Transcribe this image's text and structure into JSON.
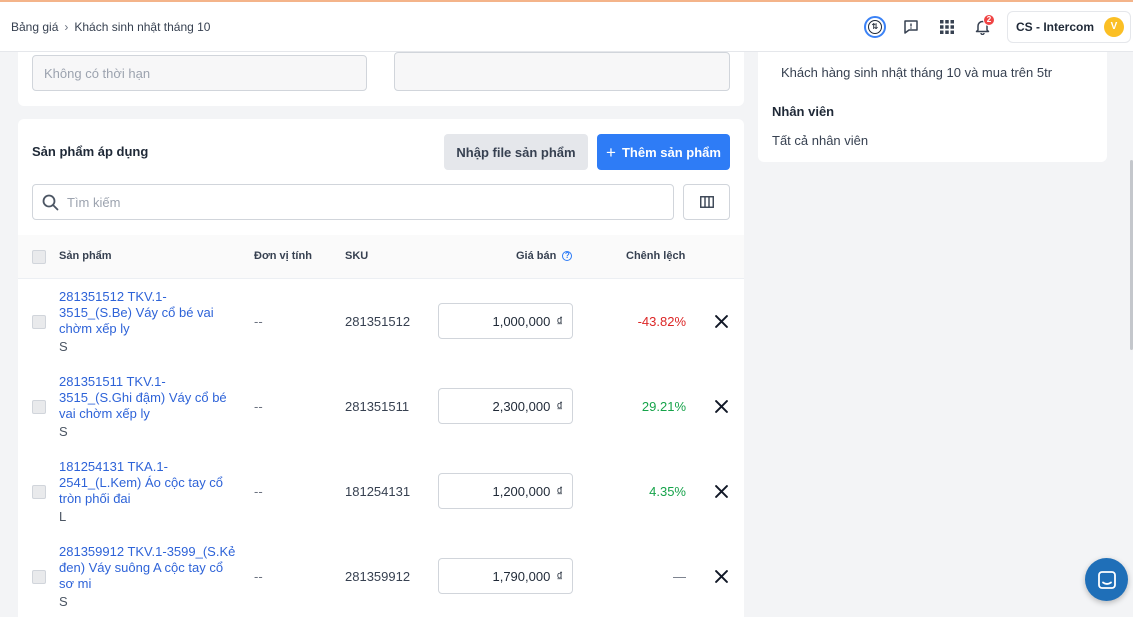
{
  "breadcrumb": {
    "root": "Bảng giá",
    "separator": "›",
    "current": "Khách sinh nhật tháng 10"
  },
  "topbar": {
    "notification_count": "2",
    "account_name": "CS - Intercom",
    "avatar_initial": "V"
  },
  "top_card": {
    "duration_placeholder": "Không có thời hạn",
    "second_field_value": ""
  },
  "right_panel": {
    "customer_condition": "Khách hàng sinh nhật tháng 10 và mua trên 5tr",
    "staff_title": "Nhân viên",
    "staff_value": "Tất cả nhân viên"
  },
  "products_section": {
    "title": "Sản phẩm áp dụng",
    "import_button": "Nhập file sản phẩm",
    "add_button": "Thêm sản phẩm",
    "search_placeholder": "Tìm kiếm",
    "columns": {
      "product": "Sản phẩm",
      "unit": "Đơn vị tính",
      "sku": "SKU",
      "price": "Giá bán",
      "diff": "Chênh lệch"
    },
    "rows": [
      {
        "name": "281351512 TKV.1-3515_(S.Be) Váy cổ bé vai chờm xếp ly",
        "variant": "S",
        "unit": "--",
        "sku": "281351512",
        "price": "1,000,000",
        "currency": "₫",
        "diff": "-43.82%",
        "diff_type": "negative"
      },
      {
        "name": "281351511 TKV.1-3515_(S.Ghi đậm) Váy cổ bé vai chờm xếp ly",
        "variant": "S",
        "unit": "--",
        "sku": "281351511",
        "price": "2,300,000",
        "currency": "₫",
        "diff": "29.21%",
        "diff_type": "positive"
      },
      {
        "name": "181254131 TKA.1-2541_(L.Kem) Áo cộc tay cổ tròn phối đai",
        "variant": "L",
        "unit": "--",
        "sku": "181254131",
        "price": "1,200,000",
        "currency": "₫",
        "diff": "4.35%",
        "diff_type": "positive"
      },
      {
        "name": "281359912 TKV.1-3599_(S.Kẻ đen) Váy suông A cộc tay cổ sơ mi",
        "variant": "S",
        "unit": "--",
        "sku": "281359912",
        "price": "1,790,000",
        "currency": "₫",
        "diff": "—",
        "diff_type": "neutral"
      }
    ]
  },
  "colors": {
    "accent": "#2e7cf6",
    "negative": "#dc2626",
    "positive": "#16a34a",
    "link": "#2e63d8"
  }
}
